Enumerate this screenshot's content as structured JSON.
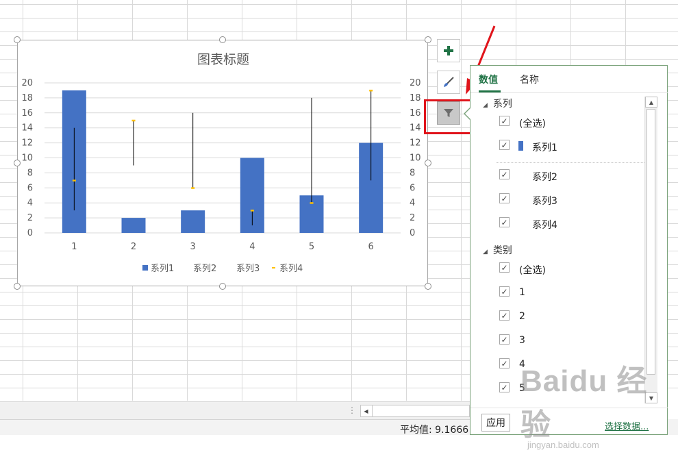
{
  "chart_data": {
    "type": "bar",
    "title": "图表标题",
    "categories": [
      "1",
      "2",
      "3",
      "4",
      "5",
      "6"
    ],
    "series": [
      {
        "name": "系列1",
        "values": [
          19,
          2,
          3,
          10,
          5,
          12
        ]
      },
      {
        "name": "系列2",
        "values": [
          14,
          15,
          16,
          1,
          18,
          19
        ]
      },
      {
        "name": "系列3",
        "values": [
          3,
          9,
          6,
          3,
          4,
          7
        ]
      },
      {
        "name": "系列4",
        "values": [
          7,
          15,
          6,
          3,
          4,
          19
        ]
      }
    ],
    "overlay": "stock high-low lines with close markers (系列2 high, 系列3 low, 系列4 close)",
    "ylim": [
      0,
      20
    ],
    "yticks": [
      "0",
      "2",
      "4",
      "6",
      "8",
      "10",
      "12",
      "14",
      "16",
      "18",
      "20"
    ],
    "secondary_yticks": [
      "0",
      "2",
      "4",
      "6",
      "8",
      "10",
      "12",
      "14",
      "16",
      "18",
      "20"
    ],
    "grid": true,
    "legend_position": "bottom",
    "colors": {
      "bar": "#4472c4",
      "marker": "#ffc000",
      "line": "#000000",
      "grid": "#d9d9d9"
    }
  },
  "side_buttons": [
    {
      "name": "chart-elements",
      "icon": "plus-icon"
    },
    {
      "name": "chart-styles",
      "icon": "brush-icon"
    },
    {
      "name": "chart-filters",
      "icon": "filter-icon",
      "active": true
    }
  ],
  "panel": {
    "tabs": [
      "数值",
      "名称"
    ],
    "active_tab": "数值",
    "series_section": {
      "title": "系列",
      "items": [
        {
          "label": "(全选)",
          "checked": true
        },
        {
          "label": "系列1",
          "checked": true,
          "swatch": "#4472c4"
        },
        {
          "label": "系列2",
          "checked": true
        },
        {
          "label": "系列3",
          "checked": true
        },
        {
          "label": "系列4",
          "checked": true
        }
      ]
    },
    "category_section": {
      "title": "类别",
      "items": [
        {
          "label": "(全选)",
          "checked": true
        },
        {
          "label": "1",
          "checked": true
        },
        {
          "label": "2",
          "checked": true
        },
        {
          "label": "3",
          "checked": true
        },
        {
          "label": "4",
          "checked": true
        },
        {
          "label": "5",
          "checked": true
        }
      ]
    },
    "apply_label": "应用",
    "select_data_label": "选择数据..."
  },
  "status": {
    "average": "平均值: 9.1666"
  },
  "watermark": {
    "main": "Baidu 经验",
    "sub": "jingyan.baidu.com"
  }
}
